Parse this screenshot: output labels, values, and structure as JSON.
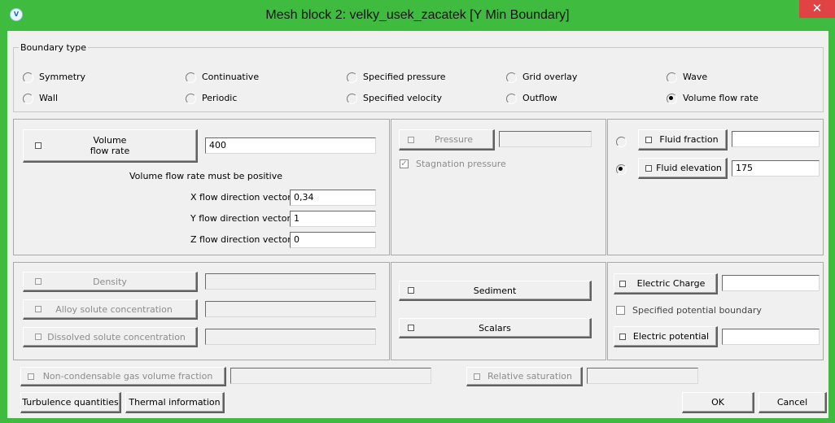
{
  "window": {
    "title": "Mesh block 2: velky_usek_zacatek [Y Min Boundary]",
    "close_glyph": "✕",
    "icon_text": "V",
    "accent_color": "#3fbb3f",
    "close_color": "#e04343"
  },
  "boundary_type": {
    "legend": "Boundary type",
    "options": [
      {
        "label": "Symmetry",
        "selected": false
      },
      {
        "label": "Continuative",
        "selected": false
      },
      {
        "label": "Specified pressure",
        "selected": false
      },
      {
        "label": "Grid overlay",
        "selected": false
      },
      {
        "label": "Wave",
        "selected": false
      },
      {
        "label": "Wall",
        "selected": false
      },
      {
        "label": "Periodic",
        "selected": false
      },
      {
        "label": "Specified velocity",
        "selected": false
      },
      {
        "label": "Outflow",
        "selected": false
      },
      {
        "label": "Volume flow rate",
        "selected": true
      }
    ]
  },
  "flow_panel": {
    "volume_flow_rate_label_line1": "Volume",
    "volume_flow_rate_label_line2": "flow rate",
    "volume_flow_rate_value": "400",
    "positive_note": "Volume flow rate must be positive",
    "x_label": "X flow direction vector",
    "x_value": "0,34",
    "y_label": "Y flow direction vector",
    "y_value": "1",
    "z_label": "Z flow direction vector",
    "z_value": "0"
  },
  "pressure_panel": {
    "pressure_label": "Pressure",
    "pressure_value": "",
    "stagnation_label": "Stagnation pressure",
    "stagnation_checked": true
  },
  "fluid_panel": {
    "fluid_fraction_label": "Fluid fraction",
    "fluid_fraction_value": "",
    "fluid_elevation_label": "Fluid elevation",
    "fluid_elevation_value": "175",
    "selected": "fluid_elevation"
  },
  "density_panel": {
    "density_label": "Density",
    "density_value": "",
    "alloy_label": "Alloy solute concentration",
    "alloy_value": "",
    "dissolved_label": "Dissolved solute concentration",
    "dissolved_value": ""
  },
  "sediment_panel": {
    "sediment_label": "Sediment",
    "scalars_label": "Scalars"
  },
  "electric_panel": {
    "charge_label": "Electric Charge",
    "charge_value": "",
    "specified_potential_label": "Specified potential boundary",
    "specified_potential_checked": false,
    "potential_label": "Electric potential",
    "potential_value": ""
  },
  "bottom": {
    "noncondensable_label": "Non-condensable gas volume fraction",
    "noncondensable_value": "",
    "relative_saturation_label": "Relative saturation",
    "relative_saturation_value": "",
    "turbulence_label": "Turbulence quantities",
    "thermal_label": "Thermal information",
    "ok_label": "OK",
    "cancel_label": "Cancel"
  }
}
